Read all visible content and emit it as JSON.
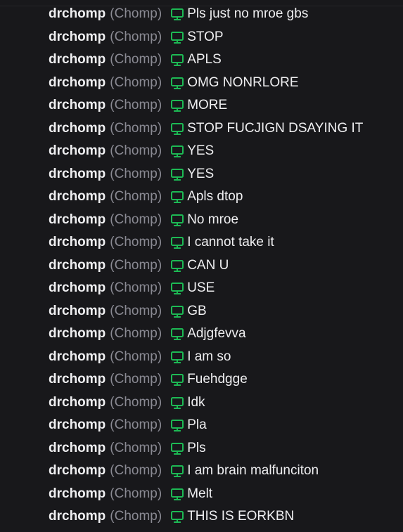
{
  "colors": {
    "background": "#18181b",
    "username": "#efeff1",
    "displayname": "#8a8a93",
    "badge": "#1db954",
    "message": "#efeff1"
  },
  "badge_icon": "monitor-icon",
  "messages": [
    {
      "username": "drchomp",
      "displayname": "(Chomp)",
      "text": "Pls just no mroe gbs"
    },
    {
      "username": "drchomp",
      "displayname": "(Chomp)",
      "text": "STOP"
    },
    {
      "username": "drchomp",
      "displayname": "(Chomp)",
      "text": "APLS"
    },
    {
      "username": "drchomp",
      "displayname": "(Chomp)",
      "text": "OMG NONRLORE"
    },
    {
      "username": "drchomp",
      "displayname": "(Chomp)",
      "text": "MORE"
    },
    {
      "username": "drchomp",
      "displayname": "(Chomp)",
      "text": "STOP FUCJIGN DSAYING IT"
    },
    {
      "username": "drchomp",
      "displayname": "(Chomp)",
      "text": "YES"
    },
    {
      "username": "drchomp",
      "displayname": "(Chomp)",
      "text": "YES"
    },
    {
      "username": "drchomp",
      "displayname": "(Chomp)",
      "text": "Apls dtop"
    },
    {
      "username": "drchomp",
      "displayname": "(Chomp)",
      "text": "No mroe"
    },
    {
      "username": "drchomp",
      "displayname": "(Chomp)",
      "text": "I cannot take it"
    },
    {
      "username": "drchomp",
      "displayname": "(Chomp)",
      "text": "CAN U"
    },
    {
      "username": "drchomp",
      "displayname": "(Chomp)",
      "text": "USE"
    },
    {
      "username": "drchomp",
      "displayname": "(Chomp)",
      "text": "GB"
    },
    {
      "username": "drchomp",
      "displayname": "(Chomp)",
      "text": "Adjgfevva"
    },
    {
      "username": "drchomp",
      "displayname": "(Chomp)",
      "text": "I am so"
    },
    {
      "username": "drchomp",
      "displayname": "(Chomp)",
      "text": "Fuehdgge"
    },
    {
      "username": "drchomp",
      "displayname": "(Chomp)",
      "text": "Idk"
    },
    {
      "username": "drchomp",
      "displayname": "(Chomp)",
      "text": "Pla"
    },
    {
      "username": "drchomp",
      "displayname": "(Chomp)",
      "text": "Pls"
    },
    {
      "username": "drchomp",
      "displayname": "(Chomp)",
      "text": "I am brain malfunciton"
    },
    {
      "username": "drchomp",
      "displayname": "(Chomp)",
      "text": "Melt"
    },
    {
      "username": "drchomp",
      "displayname": "(Chomp)",
      "text": "THIS IS EORKBN"
    }
  ]
}
